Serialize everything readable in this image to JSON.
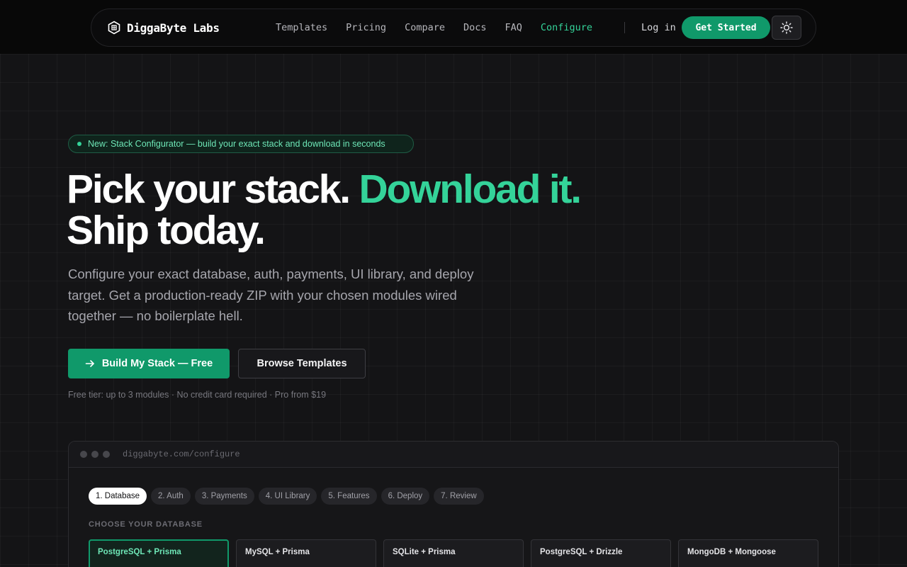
{
  "brand": {
    "name": "DiggaByte Labs"
  },
  "nav": {
    "links": [
      {
        "label": "Templates",
        "active": false
      },
      {
        "label": "Pricing",
        "active": false
      },
      {
        "label": "Compare",
        "active": false
      },
      {
        "label": "Docs",
        "active": false
      },
      {
        "label": "FAQ",
        "active": false
      },
      {
        "label": "Configure",
        "active": true
      }
    ],
    "login_label": "Log in",
    "cta_label": "Get Started",
    "theme_icon": "sun-icon"
  },
  "hero": {
    "badge": "New: Stack Configurator — build your exact stack and download in seconds",
    "headline_part1": "Pick your stack. ",
    "headline_accent": "Download it.",
    "headline_part2": "Ship today.",
    "subcopy": "Configure your exact database, auth, payments, UI library, and deploy target. Get a production-ready ZIP with your chosen modules wired together — no boilerplate hell.",
    "primary_cta": "Build My Stack — Free",
    "secondary_cta": "Browse Templates",
    "fineprint": "Free tier: up to 3 modules · No credit card required · Pro from $19"
  },
  "browser": {
    "url": "diggabyte.com/configure",
    "steps": [
      "1. Database",
      "2. Auth",
      "3. Payments",
      "4. UI Library",
      "5. Features",
      "6. Deploy",
      "7. Review"
    ],
    "active_step": 0,
    "section_label": "CHOOSE YOUR DATABASE",
    "options": [
      "PostgreSQL + Prisma",
      "MySQL + Prisma",
      "SQLite + Prisma",
      "PostgreSQL + Drizzle",
      "MongoDB + Mongoose"
    ],
    "selected_option": 0
  },
  "colors": {
    "accent": "#34d399",
    "brand_green": "#10996a",
    "background": "#141416"
  }
}
